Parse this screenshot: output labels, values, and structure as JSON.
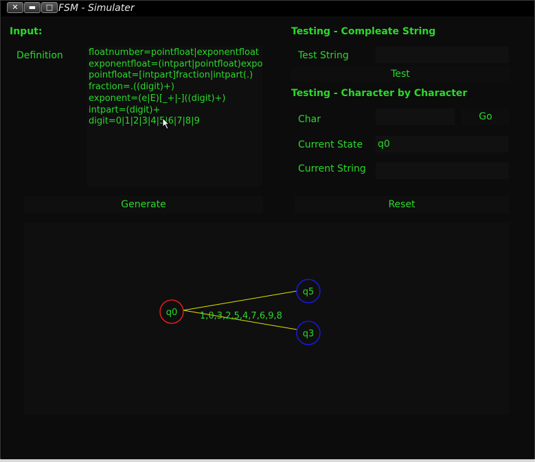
{
  "window": {
    "title": "FSM - Simulater",
    "close_glyph": "✕",
    "minimize_glyph": "▬",
    "maximize_glyph": "□"
  },
  "input": {
    "header": "Input:",
    "definition_label": "Definition",
    "definition_lines": [
      "floatnumber=pointfloat|exponentfloat",
      "exponentfloat=(intpart|pointfloat)exponent",
      "pointfloat=[intpart]fraction|intpart(.)",
      "fraction=.((digit)+)",
      "exponent=(e|E)[_+|-]((digit)+)",
      "intpart=(digit)+",
      "digit=0|1|2|3|4|5|6|7|8|9"
    ]
  },
  "testing_complete": {
    "header": "Testing - Compleate String",
    "test_string_label": "Test String",
    "test_string_value": "",
    "test_button": "Test"
  },
  "testing_char": {
    "header": "Testing - Character by Character",
    "char_label": "Char",
    "char_value": "",
    "go_button": "Go",
    "current_state_label": "Current State",
    "current_state_value": "q0",
    "current_string_label": "Current String",
    "current_string_value": ""
  },
  "actions": {
    "generate": "Generate",
    "reset": "Reset"
  },
  "graph": {
    "states": [
      {
        "id": "q0",
        "color": "#ff2020"
      },
      {
        "id": "q5",
        "color": "#1a1aff"
      },
      {
        "id": "q3",
        "color": "#1a1aff"
      }
    ],
    "edge_color": "#e6e600",
    "edge_label": "1,0,3,2,5,4,7,6,9,8"
  }
}
